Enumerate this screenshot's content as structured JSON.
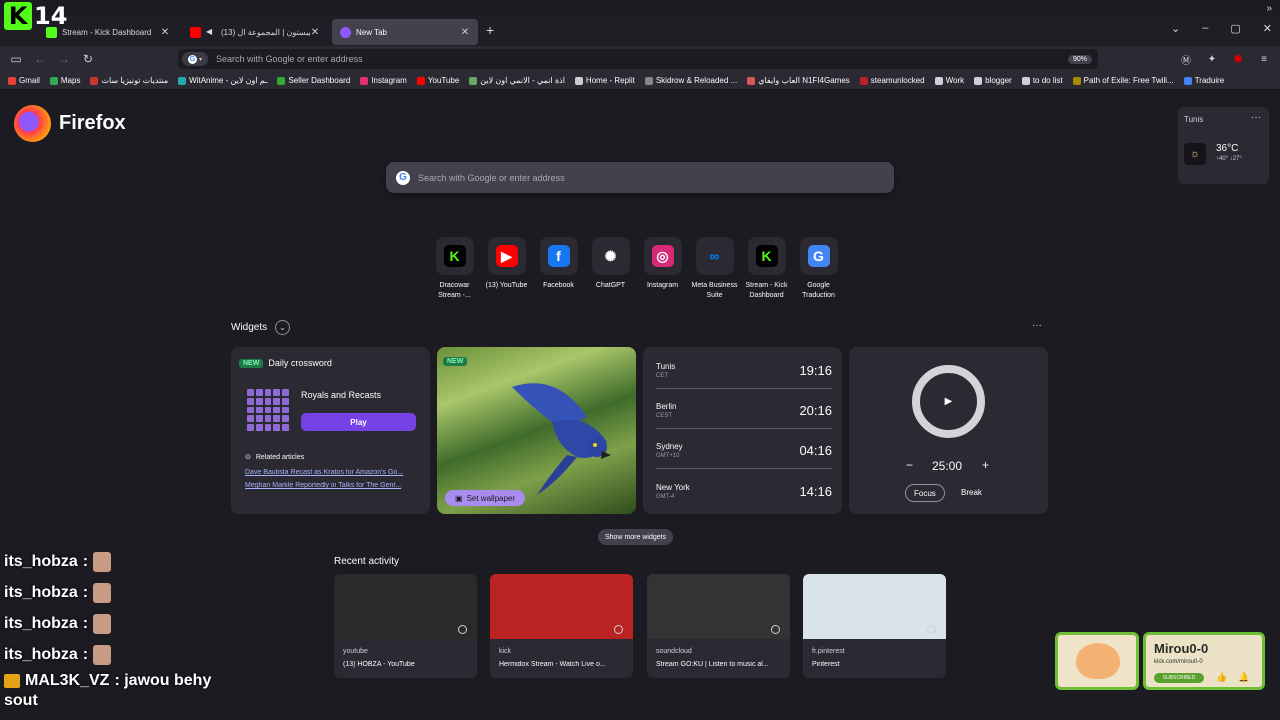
{
  "overlay": {
    "kick_num": "14"
  },
  "tabs": [
    {
      "title": "Stream - Kick Dashboard",
      "color": "#53fc18"
    },
    {
      "title": "(13) سيبستون | المجموعة ال...",
      "color": "#ff0000"
    },
    {
      "title": "New Tab",
      "color": "#9059ff"
    }
  ],
  "window_controls": {
    "min": "–",
    "max": "▢",
    "close": "✕"
  },
  "toolbar": {
    "url_placeholder": "Search with Google or enter address",
    "zoom": "90%"
  },
  "bookmarks": [
    {
      "label": "Gmail",
      "color": "#ea4335"
    },
    {
      "label": "Maps",
      "color": "#34a853"
    },
    {
      "label": "منتديات تونيزيا سات",
      "color": "#c33"
    },
    {
      "label": "WitAnime - ـم اون لاين",
      "color": "#2aa"
    },
    {
      "label": "Seller Dashboard",
      "color": "#3a3"
    },
    {
      "label": "Instagram",
      "color": "#e1306c"
    },
    {
      "label": "YouTube",
      "color": "#ff0000"
    },
    {
      "label": "اذة انمي - الانمي اون لاين",
      "color": "#6a6"
    },
    {
      "label": "Home - Replit",
      "color": "#ccc"
    },
    {
      "label": "Skidrow & Reloaded ...",
      "color": "#888"
    },
    {
      "label": "العاب وايفاي N1FI4Games",
      "color": "#d55"
    },
    {
      "label": "steamunlocked",
      "color": "#b22"
    },
    {
      "label": "Work",
      "color": "#cfcfd8"
    },
    {
      "label": "blogger",
      "color": "#cfcfd8"
    },
    {
      "label": "to do list",
      "color": "#cfcfd8"
    },
    {
      "label": "Path of Exile: Free Twili...",
      "color": "#a80"
    },
    {
      "label": "Traduire",
      "color": "#4285f4"
    }
  ],
  "brand": {
    "name": "Firefox"
  },
  "weather": {
    "city": "Tunis",
    "temp": "36°C",
    "hilo": "↑40° ↓27°",
    "menu": "···"
  },
  "search": {
    "placeholder": "Search with Google or enter address"
  },
  "top_sites": [
    {
      "label": "Dracowar Stream -...",
      "icon": "kick-icon",
      "bg": "#000",
      "fg": "#53fc18",
      "glyph": "K"
    },
    {
      "label": "(13) YouTube",
      "icon": "youtube-icon",
      "bg": "#ff0000",
      "fg": "#fff",
      "glyph": "▶"
    },
    {
      "label": "Facebook",
      "icon": "facebook-icon",
      "bg": "#1877f2",
      "fg": "#fff",
      "glyph": "f"
    },
    {
      "label": "ChatGPT",
      "icon": "chatgpt-icon",
      "bg": "#2b2a33",
      "fg": "#fff",
      "glyph": "✺"
    },
    {
      "label": "Instagram",
      "icon": "instagram-icon",
      "bg": "#d62976",
      "fg": "#fff",
      "glyph": "◎"
    },
    {
      "label": "Meta Business Suite",
      "icon": "meta-icon",
      "bg": "#2b2a33",
      "fg": "#0081fb",
      "glyph": "∞"
    },
    {
      "label": "Stream - Kick Dashboard",
      "icon": "kick-icon",
      "bg": "#000",
      "fg": "#53fc18",
      "glyph": "K"
    },
    {
      "label": "Google Traduction",
      "icon": "google-translate-icon",
      "bg": "#4285f4",
      "fg": "#fff",
      "glyph": "G"
    }
  ],
  "widgets": {
    "title": "Widgets",
    "menu": "···",
    "crossword": {
      "badge": "NEW",
      "title": "Daily crossword",
      "game": "Royals and Recasts",
      "play": "Play",
      "related": "Related articles",
      "articles": [
        "Dave Bautista Recast as Kratos for Amazon's Go...",
        "Meghan Markle Reportedly in Talks for The Gent..."
      ]
    },
    "wallpaper": {
      "badge": "NEW",
      "button": "Set wallpaper"
    },
    "clocks": [
      {
        "city": "Tunis",
        "tz": "CET",
        "time": "19:16"
      },
      {
        "city": "Berlin",
        "tz": "CEST",
        "time": "20:16"
      },
      {
        "city": "Sydney",
        "tz": "GMT+10",
        "time": "04:16"
      },
      {
        "city": "New York",
        "tz": "GMT-4",
        "time": "14:16"
      }
    ],
    "timer": {
      "value": "25:00",
      "minus": "−",
      "plus": "+",
      "focus": "Focus",
      "break": "Break"
    },
    "show_more": "Show more widgets"
  },
  "recent": {
    "title": "Recent activity",
    "items": [
      {
        "host": "youtube",
        "title": "(13) HOBZA - YouTube",
        "bg": "#2a2a2a"
      },
      {
        "host": "kick",
        "title": "Hermidox Stream - Watch Live o...",
        "bg": "#b22"
      },
      {
        "host": "soundcloud",
        "title": "Stream GO:KU | Listen to music al...",
        "bg": "#333"
      },
      {
        "host": "fr.pinterest",
        "title": "Pinterest",
        "bg": "#d9e3ea"
      }
    ]
  },
  "chat": {
    "lines": [
      {
        "user": "its_hobza",
        "sep": ":"
      },
      {
        "user": "its_hobza",
        "sep": ":"
      },
      {
        "user": "its_hobza",
        "sep": ":"
      },
      {
        "user": "its_hobza",
        "sep": ":"
      }
    ],
    "mal_user": "MAL3K_VZ",
    "mal_msg": ": jawou behy",
    "mal_cont": "sout"
  },
  "mirou": {
    "name": "Mirou0-0",
    "url": "kick.com/mirou0-0",
    "sub": "SUBSCRIBED"
  }
}
